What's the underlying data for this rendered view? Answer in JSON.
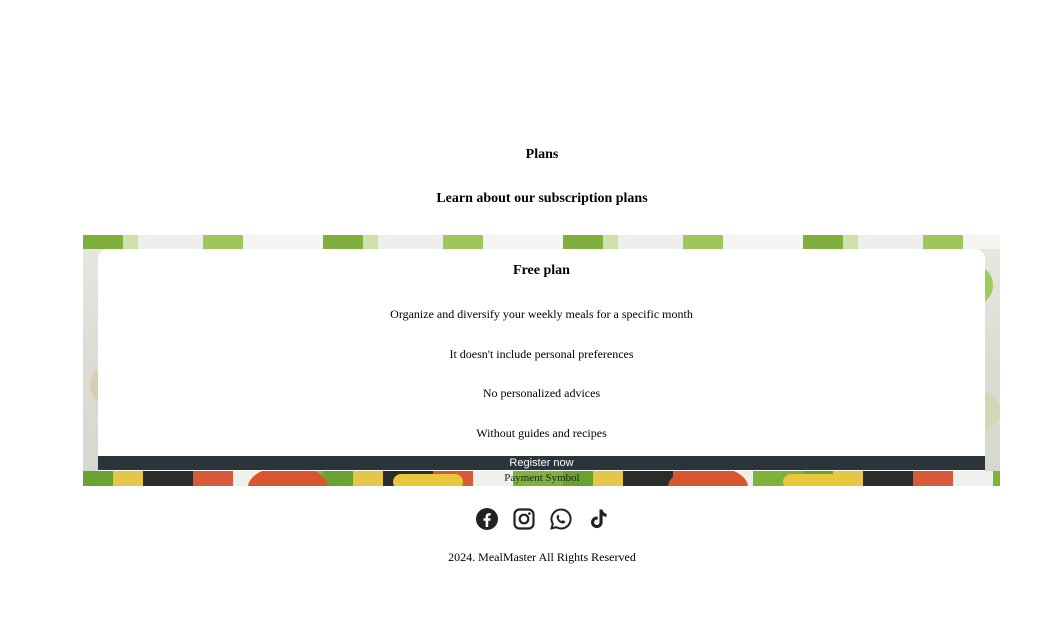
{
  "section": {
    "title": "Plans",
    "subtitle": "Learn about our subscription plans"
  },
  "plan": {
    "name": "Free plan",
    "features": [
      "Organize and diversify your weekly meals for a specific month",
      "It doesn't include personal preferences",
      "No personalized advices",
      "Without guides and recipes"
    ],
    "cta_label": "Register now"
  },
  "banner": {
    "partial_text": "Payment Symbol"
  },
  "social": {
    "icons": [
      "facebook-icon",
      "instagram-icon",
      "whatsapp-icon",
      "tiktok-icon"
    ]
  },
  "footer": {
    "copyright": "2024. MealMaster All Rights Reserved"
  },
  "colors": {
    "button_bg": "#2b3438",
    "icon": "#222222"
  }
}
